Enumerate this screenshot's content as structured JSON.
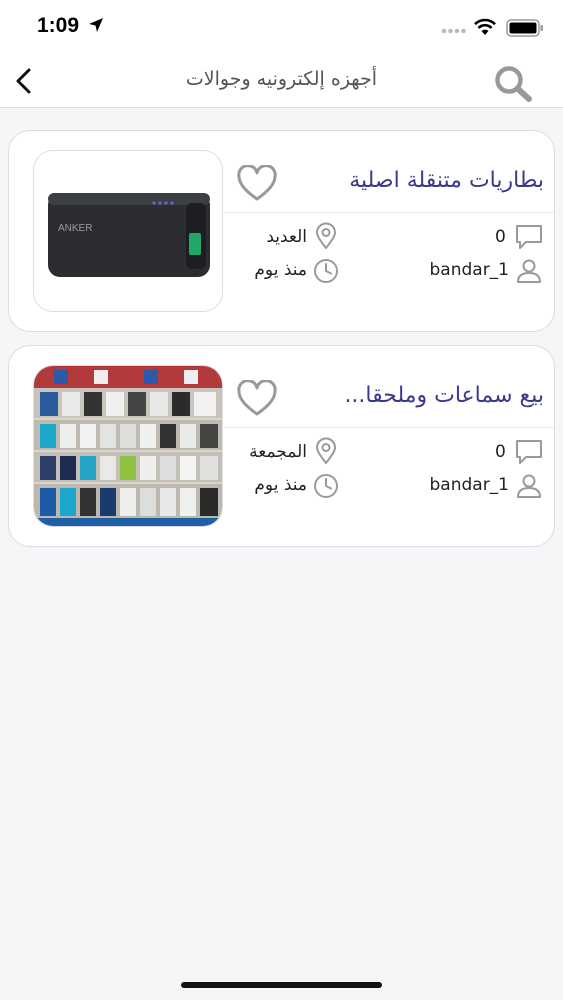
{
  "status_bar": {
    "time": "1:09"
  },
  "nav": {
    "title": "أجهزه إلكترونيه وجوالات",
    "back_icon": "chevron-left-icon",
    "search_icon": "search-icon"
  },
  "colors": {
    "accent_title": "#3a3a8c",
    "icon_gray": "#9a9a9a"
  },
  "listings": [
    {
      "title": "بطاريات متنقلة اصلية",
      "comments": "0",
      "location": "العديد",
      "user": "bandar_1",
      "time": "منذ يوم",
      "image": "power-bank-photo"
    },
    {
      "title": "بيع سماعات وملحقا...",
      "comments": "0",
      "location": "المجمعة",
      "user": "bandar_1",
      "time": "منذ يوم",
      "image": "accessories-shop-photo"
    }
  ]
}
